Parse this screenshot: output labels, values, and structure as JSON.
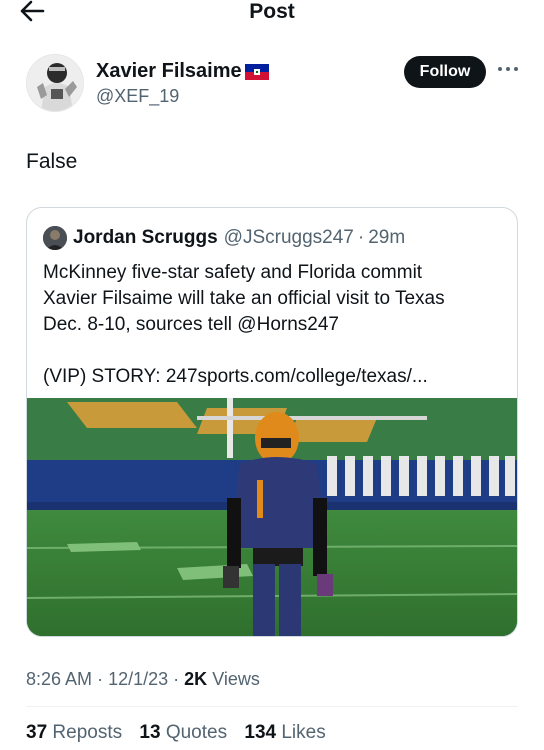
{
  "header": {
    "title": "Post",
    "back_icon": "arrow-left-icon"
  },
  "author": {
    "display_name": "Xavier Filsaime",
    "flag_icon": "haiti-flag-icon",
    "handle": "@XEF_19",
    "follow_label": "Follow",
    "more_icon": "ellipsis-icon"
  },
  "tweet": {
    "text": "False"
  },
  "quoted": {
    "name": "Jordan Scruggs",
    "handle": "@JScruggs247",
    "separator": "·",
    "time": "29m",
    "body_lines": [
      "McKinney five-star safety and Florida commit",
      "Xavier Filsaime will take an official visit to Texas",
      "Dec. 8-10, sources tell @Horns247"
    ],
    "link_line": "(VIP) STORY: 247sports.com/college/texas/..."
  },
  "meta": {
    "time": "8:26 AM",
    "sep1": "·",
    "date": "12/1/23",
    "sep2": "·",
    "views_count": "2K",
    "views_label": "Views"
  },
  "stats": {
    "reposts_count": "37",
    "reposts_label": "Reposts",
    "quotes_count": "13",
    "quotes_label": "Quotes",
    "likes_count": "134",
    "likes_label": "Likes"
  },
  "colors": {
    "text": "#0f1419",
    "secondary": "#536471",
    "border": "#cfd9de",
    "follow_bg": "#0f1419"
  }
}
